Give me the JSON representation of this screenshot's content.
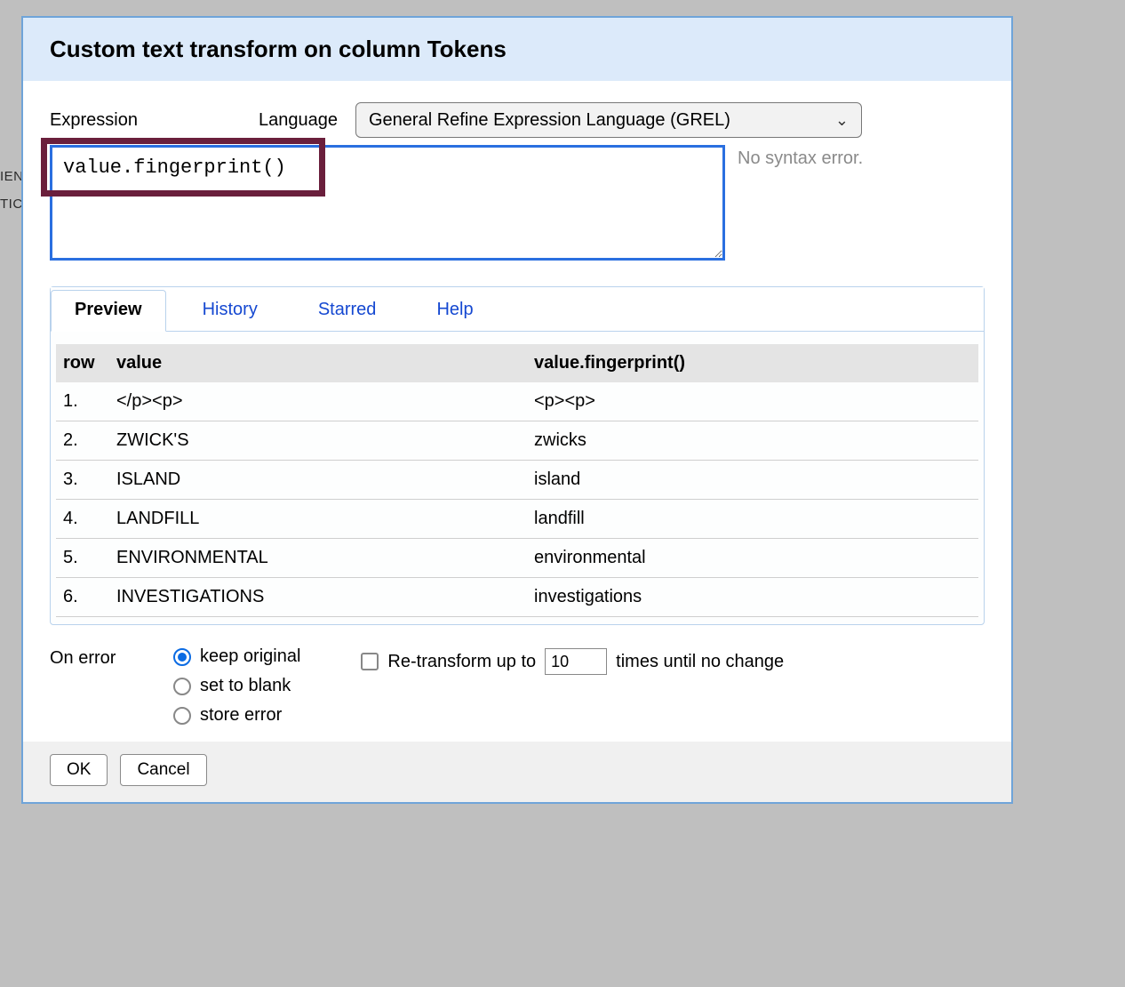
{
  "background": {
    "line1": "IEN",
    "line2": "TIC"
  },
  "dialog": {
    "title": "Custom text transform on column Tokens",
    "labels": {
      "expression": "Expression",
      "language": "Language"
    },
    "language_select": {
      "value": "General Refine Expression Language (GREL)"
    },
    "expression_value": "value.fingerprint()",
    "syntax_message": "No syntax error.",
    "tabs": {
      "preview": "Preview",
      "history": "History",
      "starred": "Starred",
      "help": "Help"
    },
    "preview": {
      "headers": {
        "row": "row",
        "value": "value",
        "result": "value.fingerprint()"
      },
      "rows": [
        {
          "n": "1.",
          "value": "</p><p>",
          "result": "<p><p>"
        },
        {
          "n": "2.",
          "value": "ZWICK'S",
          "result": "zwicks"
        },
        {
          "n": "3.",
          "value": "ISLAND",
          "result": "island"
        },
        {
          "n": "4.",
          "value": "LANDFILL",
          "result": "landfill"
        },
        {
          "n": "5.",
          "value": "ENVIRONMENTAL",
          "result": "environmental"
        },
        {
          "n": "6.",
          "value": "INVESTIGATIONS",
          "result": "investigations"
        }
      ]
    },
    "onerror": {
      "label": "On error",
      "options": {
        "keep": "keep original",
        "blank": "set to blank",
        "store": "store error"
      },
      "selected": "keep"
    },
    "retransform": {
      "label_pre": "Re-transform up to",
      "value": "10",
      "label_post": "times until no change"
    },
    "buttons": {
      "ok": "OK",
      "cancel": "Cancel"
    }
  }
}
